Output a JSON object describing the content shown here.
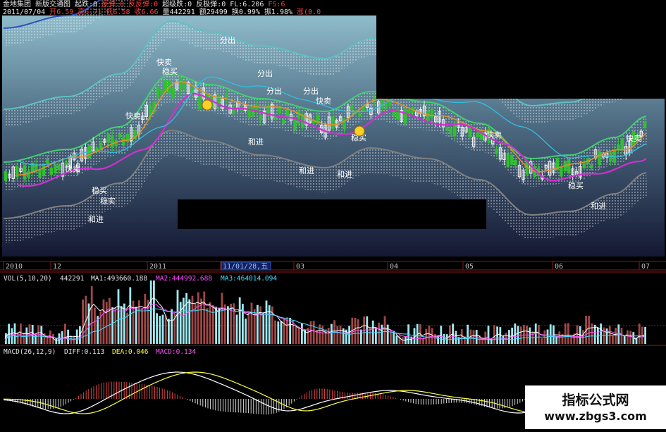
{
  "header": {
    "line1": [
      {
        "text": "金地集团",
        "color": "white"
      },
      {
        "text": "新版交通图",
        "color": "white"
      },
      {
        "text": "起跌:0",
        "color": "white"
      },
      {
        "text": "反弹:0",
        "color": "red"
      },
      {
        "text": "反反弹:0",
        "color": "red"
      },
      {
        "text": "超级跌:0",
        "color": "white"
      },
      {
        "text": "反极弹:0",
        "color": "white"
      },
      {
        "text": "FL:6.206",
        "color": "white"
      },
      {
        "text": "FS:6",
        "color": "red"
      }
    ],
    "line2": [
      {
        "text": "2011/07/04",
        "color": "white"
      },
      {
        "text": "开6.59",
        "color": "red"
      },
      {
        "text": "高6.71",
        "color": "red"
      },
      {
        "text": "低6.58",
        "color": "red"
      },
      {
        "text": "收6.66",
        "color": "red"
      },
      {
        "text": "量442291",
        "color": "white"
      },
      {
        "text": "额29499",
        "color": "white"
      },
      {
        "text": "换0.99%",
        "color": "white"
      },
      {
        "text": "振1.98%",
        "color": "white"
      },
      {
        "text": "涨(0.0",
        "color": "red"
      }
    ]
  },
  "price_panel": {
    "signals": {
      "kuaimai": "快卖",
      "wenmai": "稳买",
      "fenchu": "分出",
      "hejin": "和进",
      "wenshi": "稳实"
    }
  },
  "time_axis": {
    "labels": [
      "2010",
      "12",
      "2011",
      "11/01/28,五",
      "03",
      "04",
      "05",
      "06",
      "07"
    ],
    "cursor_label": "11/01/28,五"
  },
  "vol_panel": {
    "legend": [
      {
        "text": "VOL(5,10,20)",
        "color": "white"
      },
      {
        "text": "442291",
        "color": "white"
      },
      {
        "text": "MA1:493660.188",
        "color": "white"
      },
      {
        "text": "MA2:444992.688",
        "color": "mag"
      },
      {
        "text": "MA3:464014.094",
        "color": "cyan"
      }
    ]
  },
  "macd_panel": {
    "legend": [
      {
        "text": "MACD(26,12,9)",
        "color": "white"
      },
      {
        "text": "DIFF:0.113",
        "color": "white"
      },
      {
        "text": "DEA:0.046",
        "color": "yel"
      },
      {
        "text": "MACD:0.134",
        "color": "mag"
      }
    ]
  },
  "watermark": {
    "title": "指标公式网",
    "url": "www.zbgs3.com"
  },
  "colors": {
    "background": "#000000",
    "chart_gradient_top": "#8fbccb",
    "chart_gradient_bottom": "#1a1f3a",
    "up": "#e04848",
    "down": "#40e0ff",
    "green_candle": "#30c030",
    "band_blue": "#3050c0",
    "band_green": "#40d070",
    "grid": "#8b1a1a",
    "ma_orange": "#e09030",
    "ma_magenta": "#d030d0",
    "ma_cyan": "#30c0e0"
  },
  "chart_data": [
    {
      "type": "candlestick",
      "title": "金地集团",
      "xlabel": "",
      "ylabel": "",
      "x_ticks": [
        "2010",
        "12",
        "2011",
        "03",
        "04",
        "05",
        "06",
        "07"
      ],
      "last_bar": {
        "date": "2011/07/04",
        "open": 6.59,
        "high": 6.71,
        "low": 6.58,
        "close": 6.66,
        "volume": 442291
      }
    },
    {
      "type": "bar",
      "title": "VOL(5,10,20)",
      "series": [
        {
          "name": "VOL"
        },
        {
          "name": "MA1",
          "last": 493660.188
        },
        {
          "name": "MA2",
          "last": 444992.688
        },
        {
          "name": "MA3",
          "last": 464014.094
        }
      ],
      "last_value": 442291
    },
    {
      "type": "line",
      "title": "MACD(26,12,9)",
      "series": [
        {
          "name": "DIFF",
          "last": 0.113
        },
        {
          "name": "DEA",
          "last": 0.046
        },
        {
          "name": "MACD",
          "last": 0.134
        }
      ]
    }
  ]
}
